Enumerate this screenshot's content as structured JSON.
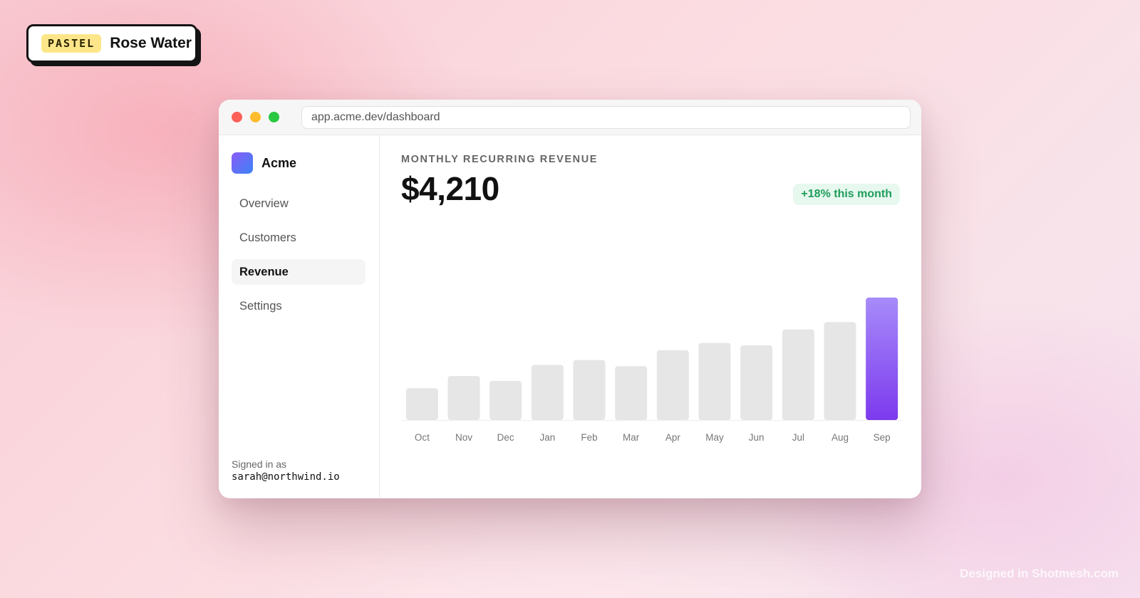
{
  "badge": {
    "tag": "PASTEL",
    "name": "Rose Water"
  },
  "window": {
    "url": "app.acme.dev/dashboard",
    "controls": [
      "close",
      "minimize",
      "maximize"
    ]
  },
  "sidebar": {
    "brand": "Acme",
    "items": [
      {
        "label": "Overview",
        "active": false
      },
      {
        "label": "Customers",
        "active": false
      },
      {
        "label": "Revenue",
        "active": true
      },
      {
        "label": "Settings",
        "active": false
      }
    ],
    "signed_in_label": "Signed in as",
    "signed_in_email": "sarah@northwind.io"
  },
  "main": {
    "metric_label": "MONTHLY RECURRING REVENUE",
    "metric_value": "$4,210",
    "delta": "+18% this month"
  },
  "chart_data": {
    "type": "bar",
    "categories": [
      "Oct",
      "Nov",
      "Dec",
      "Jan",
      "Feb",
      "Mar",
      "Apr",
      "May",
      "Jun",
      "Jul",
      "Aug",
      "Sep"
    ],
    "values": [
      26,
      36,
      32,
      45,
      49,
      44,
      57,
      63,
      61,
      74,
      80,
      100
    ],
    "ylim": [
      0,
      100
    ],
    "highlight_index": 11,
    "colors": {
      "bar": "#e6e6e6",
      "highlight_top": "#a78bfa",
      "highlight_bottom": "#7c3aed"
    },
    "title": "",
    "xlabel": "",
    "ylabel": "",
    "grid": false,
    "legend": "none"
  },
  "watermark": "Designed in Shotmesh.com"
}
